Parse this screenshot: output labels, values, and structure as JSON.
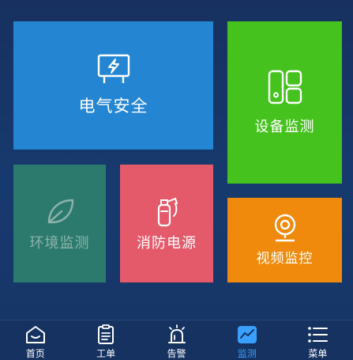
{
  "tiles": {
    "electrical_safety": "电气安全",
    "equipment_monitoring": "设备监测",
    "environment_monitoring": "环境监测",
    "fire_power": "消防电源",
    "video_monitoring": "视频监控"
  },
  "tabbar": {
    "items": [
      {
        "label": "首页",
        "icon": "home-icon"
      },
      {
        "label": "工单",
        "icon": "clipboard-icon"
      },
      {
        "label": "告警",
        "icon": "alarm-icon"
      },
      {
        "label": "监测",
        "icon": "chart-icon",
        "active": true
      },
      {
        "label": "菜单",
        "icon": "menu-icon"
      }
    ]
  },
  "colors": {
    "background": "#173a6e",
    "electrical": "#2485d3",
    "equipment": "#45c21e",
    "environment": "#2c7a6e",
    "fire": "#e45a6b",
    "video": "#f08a0c",
    "active_tab": "#3aa0ff"
  }
}
